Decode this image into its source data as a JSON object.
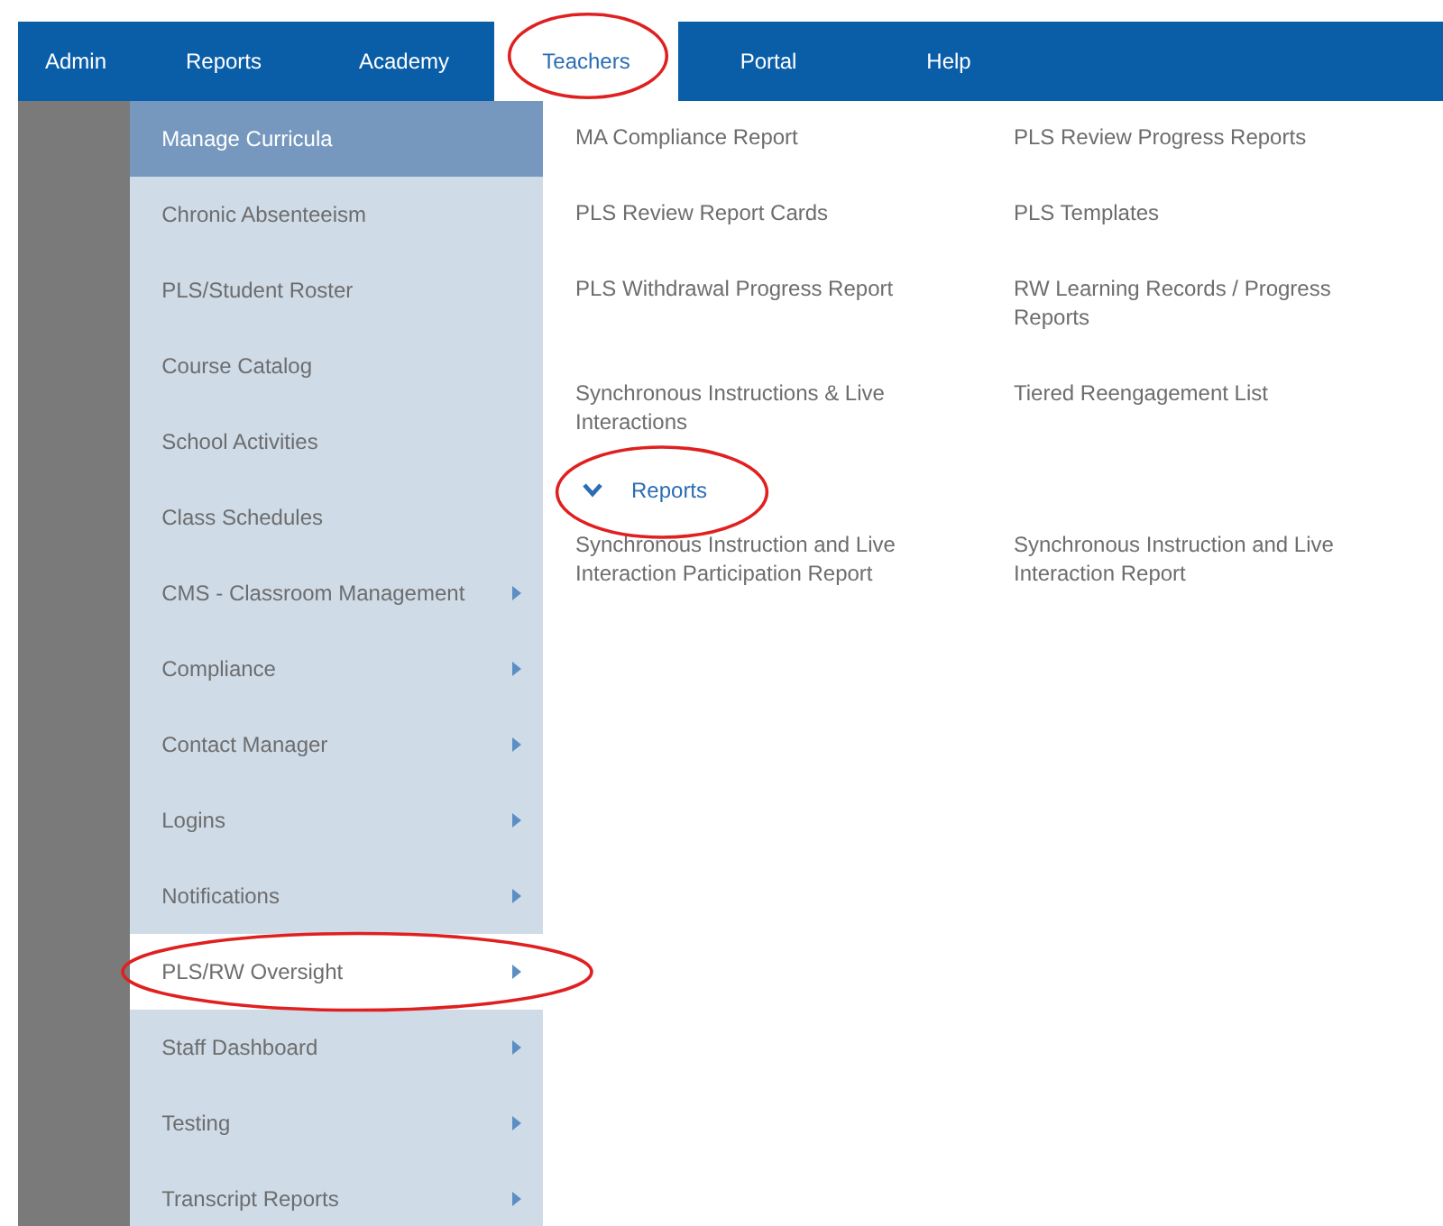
{
  "nav": {
    "tabs": [
      {
        "label": "Admin",
        "selected": false,
        "circled": false
      },
      {
        "label": "Reports",
        "selected": false,
        "circled": false
      },
      {
        "label": "Academy",
        "selected": false,
        "circled": false
      },
      {
        "label": "Teachers",
        "selected": true,
        "circled": true
      },
      {
        "label": "Portal",
        "selected": false,
        "circled": false
      },
      {
        "label": "Help",
        "selected": false,
        "circled": false
      }
    ]
  },
  "menu": {
    "items": [
      {
        "label": "Manage Curricula",
        "hovered": true,
        "selected": false,
        "has_submenu": false,
        "circled": false
      },
      {
        "label": "Chronic Absenteeism",
        "hovered": false,
        "selected": false,
        "has_submenu": false,
        "circled": false
      },
      {
        "label": "PLS/Student Roster",
        "hovered": false,
        "selected": false,
        "has_submenu": false,
        "circled": false
      },
      {
        "label": "Course Catalog",
        "hovered": false,
        "selected": false,
        "has_submenu": false,
        "circled": false
      },
      {
        "label": "School Activities",
        "hovered": false,
        "selected": false,
        "has_submenu": false,
        "circled": false
      },
      {
        "label": "Class Schedules",
        "hovered": false,
        "selected": false,
        "has_submenu": false,
        "circled": false
      },
      {
        "label": "CMS - Classroom Management",
        "hovered": false,
        "selected": false,
        "has_submenu": true,
        "circled": false
      },
      {
        "label": "Compliance",
        "hovered": false,
        "selected": false,
        "has_submenu": true,
        "circled": false
      },
      {
        "label": "Contact Manager",
        "hovered": false,
        "selected": false,
        "has_submenu": true,
        "circled": false
      },
      {
        "label": "Logins",
        "hovered": false,
        "selected": false,
        "has_submenu": true,
        "circled": false
      },
      {
        "label": "Notifications",
        "hovered": false,
        "selected": false,
        "has_submenu": true,
        "circled": false
      },
      {
        "label": "PLS/RW Oversight",
        "hovered": false,
        "selected": true,
        "has_submenu": true,
        "circled": true
      },
      {
        "label": "Staff Dashboard",
        "hovered": false,
        "selected": false,
        "has_submenu": true,
        "circled": false
      },
      {
        "label": "Testing",
        "hovered": false,
        "selected": false,
        "has_submenu": true,
        "circled": false
      },
      {
        "label": "Transcript Reports",
        "hovered": false,
        "selected": false,
        "has_submenu": true,
        "circled": false
      }
    ]
  },
  "submenu": {
    "links": [
      "MA Compliance Report",
      "PLS Review Progress Reports",
      "PLS Review Report Cards",
      "PLS Templates",
      "PLS Withdrawal Progress Report",
      "RW Learning Records / Progress Reports",
      "Synchronous Instructions & Live Interactions",
      "Tiered Reengagement List"
    ],
    "sections": [
      {
        "header": "Reports",
        "expanded": true,
        "circled": true,
        "links": [
          "Synchronous Instruction and Live Interaction Participation Report",
          "Synchronous Instruction and Live Interaction Report"
        ]
      }
    ]
  }
}
